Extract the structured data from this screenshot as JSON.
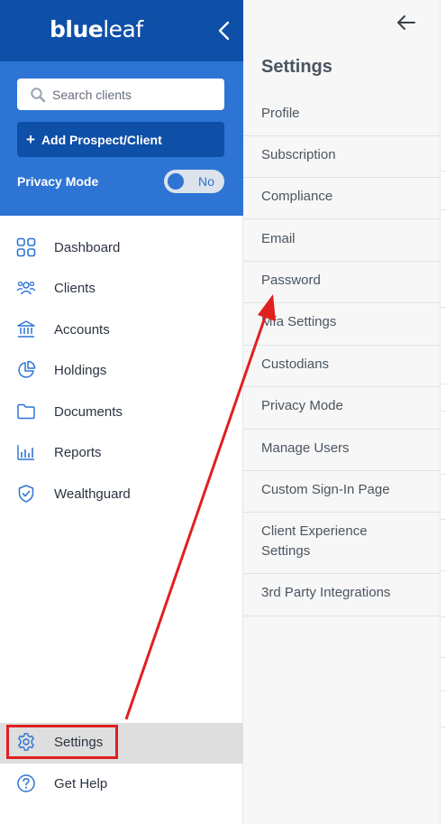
{
  "sidebar": {
    "logo": {
      "part1": "blue",
      "part2": "leaf"
    },
    "search": {
      "placeholder": "Search clients",
      "value": ""
    },
    "add_button": {
      "label": "Add Prospect/Client"
    },
    "privacy": {
      "label": "Privacy Mode",
      "toggle_value": "No"
    },
    "nav": [
      {
        "label": "Dashboard",
        "icon": "grid-icon"
      },
      {
        "label": "Clients",
        "icon": "people-icon"
      },
      {
        "label": "Accounts",
        "icon": "bank-icon"
      },
      {
        "label": "Holdings",
        "icon": "pie-chart-icon"
      },
      {
        "label": "Documents",
        "icon": "folder-icon"
      },
      {
        "label": "Reports",
        "icon": "bar-chart-icon"
      },
      {
        "label": "Wealthguard",
        "icon": "shield-check-icon"
      }
    ],
    "bottom_nav": [
      {
        "label": "Settings",
        "icon": "gear-icon",
        "active": true
      },
      {
        "label": "Get Help",
        "icon": "help-circle-icon"
      }
    ]
  },
  "settings_panel": {
    "title": "Settings",
    "items": [
      {
        "label": "Profile"
      },
      {
        "label": "Subscription"
      },
      {
        "label": "Compliance"
      },
      {
        "label": "Email"
      },
      {
        "label": "Password"
      },
      {
        "label": "Mfa Settings"
      },
      {
        "label": "Custodians"
      },
      {
        "label": "Privacy Mode"
      },
      {
        "label": "Manage Users"
      },
      {
        "label": "Custom Sign-In Page"
      },
      {
        "label": "Client Experience Settings"
      },
      {
        "label": "3rd Party Integrations"
      }
    ]
  },
  "colors": {
    "brand_dark": "#0e4fa8",
    "brand_blue": "#2d74d4",
    "annotation_red": "#e02020",
    "active_bg": "#dedede"
  }
}
